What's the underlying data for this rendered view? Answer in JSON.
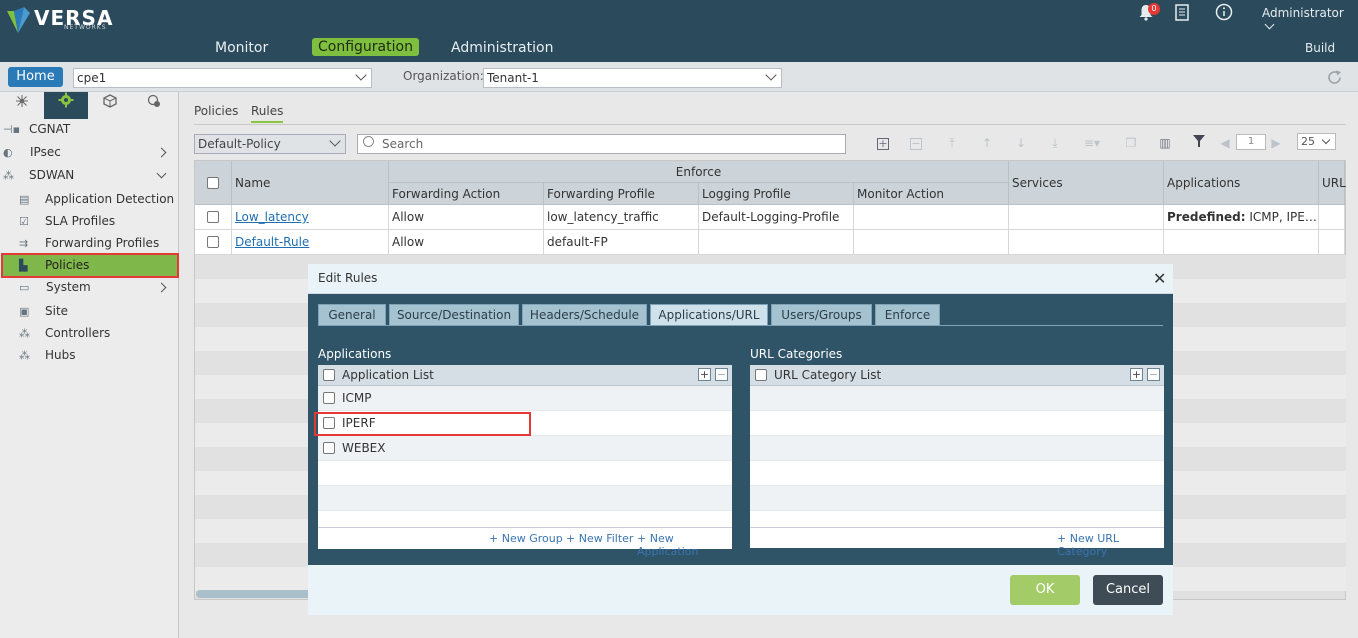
{
  "header": {
    "brand": "VERSA",
    "brand_sub": "NETWORKS",
    "nav": [
      "Monitor",
      "Configuration",
      "Administration"
    ],
    "active_nav": "Configuration",
    "notification_count": "0",
    "user": "Administrator",
    "build_label": "Build"
  },
  "subbar": {
    "home_label": "Home",
    "device": "cpe1",
    "org_label": "Organization:",
    "org_value": "Tenant-1"
  },
  "sidebar": {
    "items": [
      {
        "label": "CGNAT"
      },
      {
        "label": "IPsec"
      },
      {
        "label": "SDWAN"
      },
      {
        "label": "Application Detection"
      },
      {
        "label": "SLA Profiles"
      },
      {
        "label": "Forwarding Profiles"
      },
      {
        "label": "Policies"
      },
      {
        "label": "System"
      },
      {
        "label": "Site"
      },
      {
        "label": "Controllers"
      },
      {
        "label": "Hubs"
      }
    ]
  },
  "main": {
    "tabs": [
      "Policies",
      "Rules"
    ],
    "active_tab": "Rules",
    "policy_select": "Default-Policy",
    "search_placeholder": "Search",
    "page": "1",
    "page_size": "25",
    "grid": {
      "group_header": "Enforce",
      "columns": [
        "Name",
        "Forwarding Action",
        "Forwarding Profile",
        "Logging Profile",
        "Monitor Action",
        "Services",
        "Applications",
        "URL"
      ],
      "rows": [
        {
          "name": "Low_latency",
          "forwarding_action": "Allow",
          "forwarding_profile": "low_latency_traffic",
          "logging_profile": "Default-Logging-Profile",
          "monitor_action": "",
          "services": "",
          "applications_prefix": "Predefined:",
          "applications": "ICMP, IPERF, ..."
        },
        {
          "name": "Default-Rule",
          "forwarding_action": "Allow",
          "forwarding_profile": "default-FP",
          "logging_profile": "",
          "monitor_action": "",
          "services": "",
          "applications_prefix": "",
          "applications": ""
        }
      ]
    }
  },
  "dialog": {
    "title": "Edit Rules",
    "tabs": [
      "General",
      "Source/Destination",
      "Headers/Schedule",
      "Applications/URL",
      "Users/Groups",
      "Enforce"
    ],
    "active_tab": "Applications/URL",
    "applications": {
      "title": "Applications",
      "header": "Application List",
      "items": [
        "ICMP",
        "IPERF",
        "WEBEX"
      ],
      "links": [
        "+ New Group",
        "+ New Filter",
        "+ New Application"
      ]
    },
    "url_categories": {
      "title": "URL Categories",
      "header": "URL Category List",
      "links": [
        "+ New URL Category"
      ]
    },
    "ok_label": "OK",
    "cancel_label": "Cancel"
  },
  "colors": {
    "header_bg": "#2b4a5c",
    "accent_green": "#7fbf3f",
    "home_blue": "#2a7ab8",
    "highlight_red": "#e53935",
    "dialog_bg": "#2f5367"
  }
}
